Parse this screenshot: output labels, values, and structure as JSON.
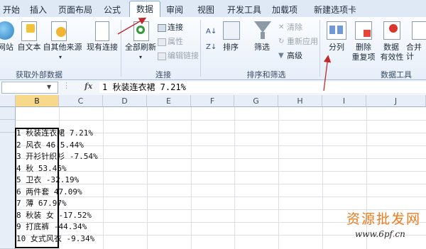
{
  "tabs": [
    "开始",
    "插入",
    "页面布局",
    "公式",
    "数据",
    "审阅",
    "视图",
    "开发工具",
    "加载项",
    "新建选项卡"
  ],
  "active_tab": "数据",
  "ribbon": {
    "group_external": {
      "label": "获取外部数据",
      "web": "网站",
      "text": "自文本",
      "other_top": "自其他来源",
      "existing": "现有连接"
    },
    "group_connections": {
      "label": "连接",
      "refresh_all": "全部刷新",
      "connections": "连接",
      "properties": "属性",
      "edit_links": "编辑链接"
    },
    "group_sort": {
      "label": "排序和筛选",
      "sort": "排序",
      "filter": "筛选",
      "clear": "清除",
      "reapply": "重新应用",
      "advanced": "高级"
    },
    "group_tools": {
      "label": "数据工具",
      "text_to_columns": "分列",
      "remove_dup_1": "删除",
      "remove_dup_2": "重复项",
      "validation_1": "数据",
      "validation_2": "有效性",
      "consolidate": "合并计"
    }
  },
  "formula_bar": {
    "name_box": "",
    "fx": "fx",
    "formula": "1 秋装连衣裙 7.21%"
  },
  "columns": [
    "B",
    "C",
    "D",
    "E",
    "F",
    "G",
    "H",
    "I",
    "J"
  ],
  "selected_column": "B",
  "cells": [
    "1 秋装连衣裙 7.21%",
    "2 风衣 46.5.44%",
    "3 开衫针织衫 -7.54%",
    "4 秋 53.46%",
    "5 卫衣 -32.19%",
    "6 两件套 47.09%",
    "7 薄 67.97%",
    "8 秋装 女 -17.52%",
    "9 打底裤 -44.34%",
    "10 女式风衣 -9.34%"
  ],
  "watermark": {
    "title": "资源批发网",
    "url_prefix": "www.",
    "url_host": "6pf",
    "url_dot": ".",
    "url_tld": "cn"
  },
  "colors": {
    "tab_bar": "#dfe8f5",
    "selected_header": "#f8d88a",
    "annotation_arrow": "#c0282a",
    "watermark": "#f07a1e"
  }
}
